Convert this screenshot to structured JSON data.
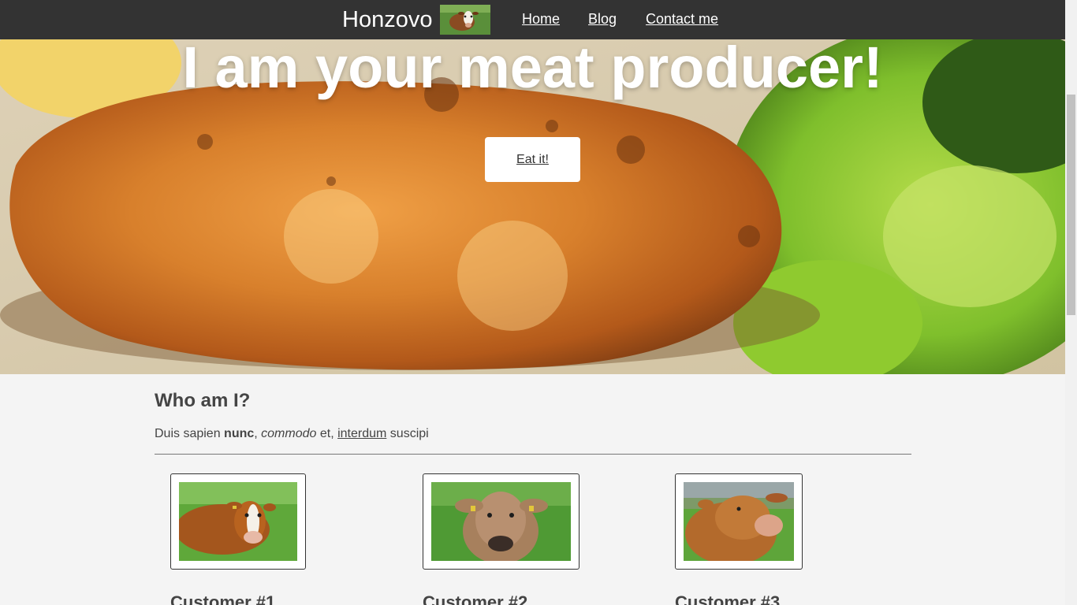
{
  "navbar": {
    "brand": "Honzovo",
    "links": [
      "Home",
      "Blog",
      "Contact me"
    ]
  },
  "hero": {
    "title": "I am your meat producer!",
    "button": "Eat it!"
  },
  "about": {
    "title": "Who am I?",
    "text_plain_1": "Duis sapien ",
    "text_bold": "nunc",
    "text_plain_2": ", ",
    "text_italic": "commodo",
    "text_plain_3": " et, ",
    "text_link": "interdum",
    "text_plain_4": " suscipi"
  },
  "customers": [
    {
      "name": "Customer #1"
    },
    {
      "name": "Customer #2"
    },
    {
      "name": "Customer #3"
    }
  ],
  "colors": {
    "navbar": "#333333",
    "page_background": "#f4f4f4",
    "text": "#444444"
  }
}
